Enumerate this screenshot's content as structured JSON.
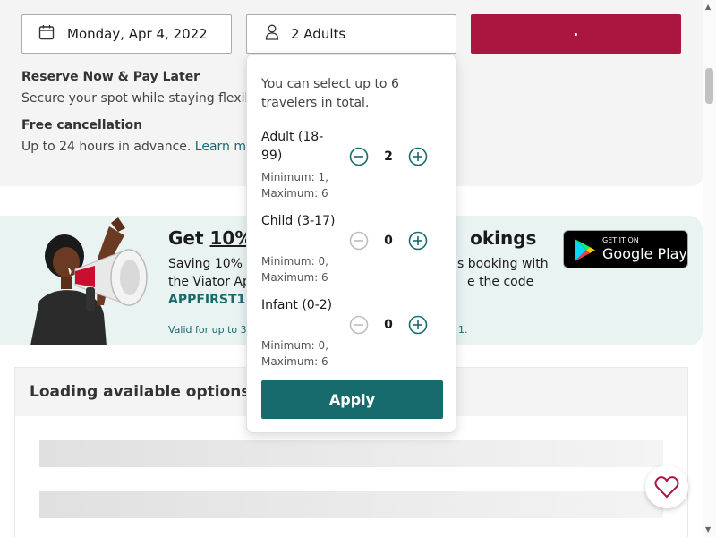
{
  "booking": {
    "date_label": "Monday, Apr 4, 2022",
    "travelers_label": "2 Adults"
  },
  "info": {
    "reserve_title": "Reserve Now & Pay Later",
    "reserve_text": "Secure your spot while staying flexib",
    "cancel_title": "Free cancellation",
    "cancel_text": "Up to 24 hours in advance. ",
    "learn_more": "Learn mo"
  },
  "promo": {
    "headline_start": "Get ",
    "headline_underlined": "10% o",
    "headline_end": "okings",
    "sub_text_left": "Saving 10% o",
    "sub_text_left2": "the Viator Ap",
    "sub_text_right": "s booking with",
    "sub_text_right2": "e the code",
    "code": "APPFIRST10",
    "valid_left": "Valid for up to 3 l",
    "valid_right": "1.",
    "store_small": "GET IT ON",
    "store_big": "Google Play"
  },
  "loading": {
    "title": "Loading available options"
  },
  "travelers_dropdown": {
    "note": "You can select up to 6 travelers in total.",
    "rows": [
      {
        "label": "Adult (18-99)",
        "limits": "Minimum: 1, Maximum: 6",
        "count": "2"
      },
      {
        "label": "Child (3-17)",
        "limits": "Minimum: 0, Maximum: 6",
        "count": "0"
      },
      {
        "label": "Infant (0-2)",
        "limits": "Minimum: 0, Maximum: 6",
        "count": "0"
      }
    ],
    "apply_label": "Apply"
  },
  "colors": {
    "brand_red": "#aa1640",
    "accent_teal": "#186b6d"
  },
  "icons": {
    "date": "calendar-icon",
    "travelers": "person-icon",
    "minus": "minus-circle-icon",
    "plus": "plus-circle-icon",
    "favorite": "heart-icon",
    "store": "google-play-icon"
  }
}
